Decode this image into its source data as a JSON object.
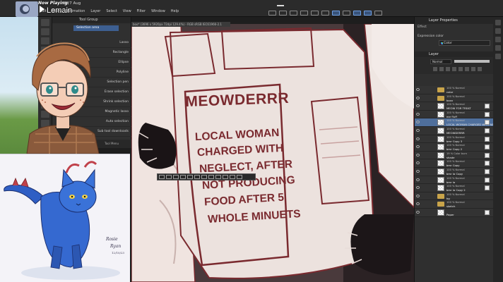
{
  "now_playing": {
    "label": "Now Playing:",
    "title": "Lemain"
  },
  "topbar": {
    "datetime": "Fri 7 Aug",
    "menu": [
      "Edit",
      "Story",
      "Animation",
      "Layer",
      "Select",
      "View",
      "Filter",
      "Window",
      "Help"
    ]
  },
  "subtool": {
    "header": "Tool Group",
    "active_tab": "Selection area",
    "items": [
      "Lasso",
      "Rectangle",
      "Ellipse",
      "Polyline",
      "Selection pen",
      "Erase selection",
      "Shrink selection",
      "Magnetic lasso",
      "Auto selection",
      "Sub tool downloads"
    ],
    "footer": "Tool Menu"
  },
  "canvas": {
    "doc_title": "boo* (3696 x 5920px 72dpi 129.4%) - RGB sRGB IEC61966-2.1"
  },
  "newspaper": {
    "headline": "MEOWDERRR",
    "lines": [
      "LOCAL WOMAN",
      "CHARGED WITH",
      "NEGLECT, AFTER",
      "NOT PRODUCING",
      "FOOD AFTER 5",
      "WHOLE MINUETS"
    ]
  },
  "cat_art": {
    "signature_1": "Rosie",
    "signature_2": "Ryan",
    "signature_3": "12/10/23"
  },
  "layer_properties": {
    "title": "Layer Properties",
    "effect_label": "Effect",
    "expression_label": "Expression color",
    "expression_value": "Color"
  },
  "layer_panel": {
    "title": "Layer",
    "blend_mode": "Normal",
    "opacity_percent": 100,
    "layers": [
      {
        "mode": "100 % Normal",
        "name": "color",
        "kind": "folder"
      },
      {
        "mode": "100 % Normal",
        "name": "boxx",
        "kind": "folder"
      },
      {
        "mode": "100 % Normal",
        "name": "MEOW FOR TREAT",
        "kind": "layer"
      },
      {
        "mode": "100 % Normal",
        "name": "ear fluff",
        "kind": "layer"
      },
      {
        "mode": "100 % Normal",
        "name": "LOCAL WOMAN CHARGED WITH NEGL...",
        "kind": "layer",
        "selected": true
      },
      {
        "mode": "100 % Normal",
        "name": "MEOWDERRR",
        "kind": "layer"
      },
      {
        "mode": "100 % Normal",
        "name": "bmr Copy 3",
        "kind": "layer"
      },
      {
        "mode": "100 % Normal",
        "name": "bmr Copy 2",
        "kind": "layer"
      },
      {
        "mode": "19 % Color burn",
        "name": "shade",
        "kind": "layer"
      },
      {
        "mode": "100 % Normal",
        "name": "bmr Copy",
        "kind": "layer"
      },
      {
        "mode": "100 % Normal",
        "name": "bmr la Copy",
        "kind": "layer"
      },
      {
        "mode": "100 % Normal",
        "name": "bmr la",
        "kind": "layer"
      },
      {
        "mode": "100 % Normal",
        "name": "bmr la Copy 2",
        "kind": "layer"
      },
      {
        "mode": "100 % Normal",
        "name": "bg",
        "kind": "folder"
      },
      {
        "mode": "100 % Normal",
        "name": "sketch",
        "kind": "folder"
      },
      {
        "mode": "",
        "name": "Paper",
        "kind": "layer"
      }
    ]
  }
}
